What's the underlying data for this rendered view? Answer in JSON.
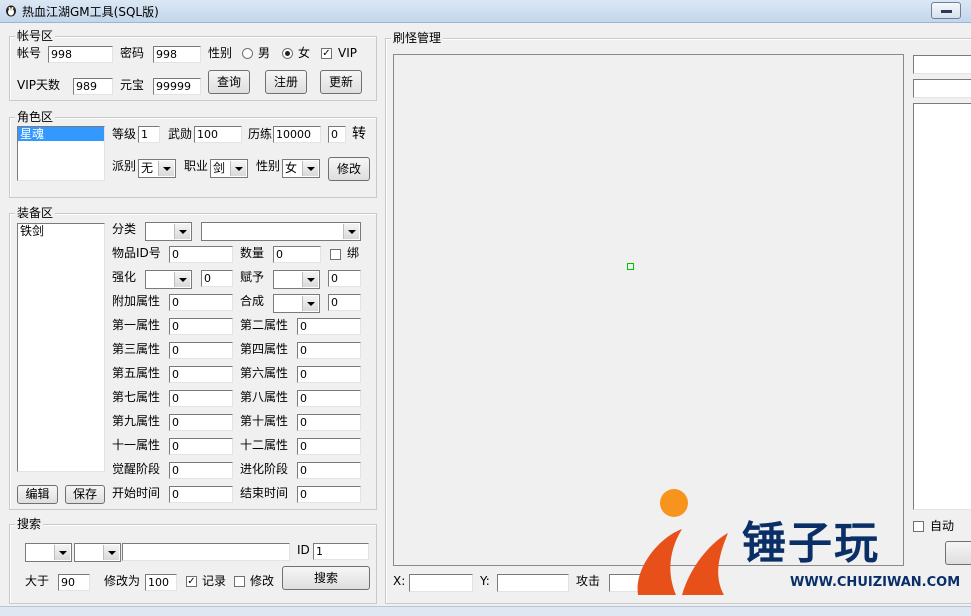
{
  "window": {
    "title": "热血江湖GM工具(SQL版)"
  },
  "account": {
    "group_label": "帐号区",
    "account_label": "帐号",
    "account_value": "998",
    "password_label": "密码",
    "password_value": "998",
    "gender_label": "性别",
    "gender_male": "男",
    "gender_female": "女",
    "gender_selected": "女",
    "vip_label": "VIP",
    "vip_checked": true,
    "vip_days_label": "VIP天数",
    "vip_days_value": "989",
    "yuanbao_label": "元宝",
    "yuanbao_value": "99999",
    "query_button": "查询",
    "register_button": "注册",
    "update_button": "更新"
  },
  "character": {
    "group_label": "角色区",
    "list": [
      "星魂"
    ],
    "level_label": "等级",
    "level_value": "1",
    "martial_label": "武勋",
    "martial_value": "100",
    "exp_label": "历练",
    "exp_value": "10000",
    "turn_value": "0",
    "turn_label": "转",
    "faction_label": "派别",
    "faction_value": "无",
    "job_label": "职业",
    "job_value": "剑",
    "gender_label": "性别",
    "gender_value": "女",
    "modify_button": "修改"
  },
  "equipment": {
    "group_label": "装备区",
    "list": [
      "铁剑"
    ],
    "category_label": "分类",
    "item_id_label": "物品ID号",
    "item_id_value": "0",
    "qty_label": "数量",
    "qty_value": "0",
    "bind_label": "绑",
    "enhance_label": "强化",
    "enhance_value": "0",
    "grant_label": "赋予",
    "grant_value": "0",
    "extra_label": "附加属性",
    "extra_value": "0",
    "compose_label": "合成",
    "compose_value": "0",
    "attrs": [
      {
        "label": "第一属性",
        "value": "0"
      },
      {
        "label": "第二属性",
        "value": "0"
      },
      {
        "label": "第三属性",
        "value": "0"
      },
      {
        "label": "第四属性",
        "value": "0"
      },
      {
        "label": "第五属性",
        "value": "0"
      },
      {
        "label": "第六属性",
        "value": "0"
      },
      {
        "label": "第七属性",
        "value": "0"
      },
      {
        "label": "第八属性",
        "value": "0"
      },
      {
        "label": "第九属性",
        "value": "0"
      },
      {
        "label": "第十属性",
        "value": "0"
      },
      {
        "label": "十一属性",
        "value": "0"
      },
      {
        "label": "十二属性",
        "value": "0"
      }
    ],
    "awaken_label": "觉醒阶段",
    "awaken_value": "0",
    "evolve_label": "进化阶段",
    "evolve_value": "0",
    "start_label": "开始时间",
    "start_value": "0",
    "end_label": "结束时间",
    "end_value": "0",
    "edit_button": "编辑",
    "save_button": "保存"
  },
  "search": {
    "group_label": "搜索",
    "id_label": "ID",
    "id_value": "1",
    "greater_label": "大于",
    "greater_value": "90",
    "modify_to_label": "修改为",
    "modify_to_value": "100",
    "record_label": "记录",
    "record_checked": true,
    "modify_label": "修改",
    "modify_checked": false,
    "search_button": "搜索"
  },
  "monster": {
    "group_label": "刷怪管理",
    "x_label": "X:",
    "y_label": "Y:",
    "attack_label": "攻击",
    "auto_label": "自动"
  },
  "watermark": {
    "brand": "锤子玩",
    "url": "WWW.CHUIZIWAN.COM"
  }
}
